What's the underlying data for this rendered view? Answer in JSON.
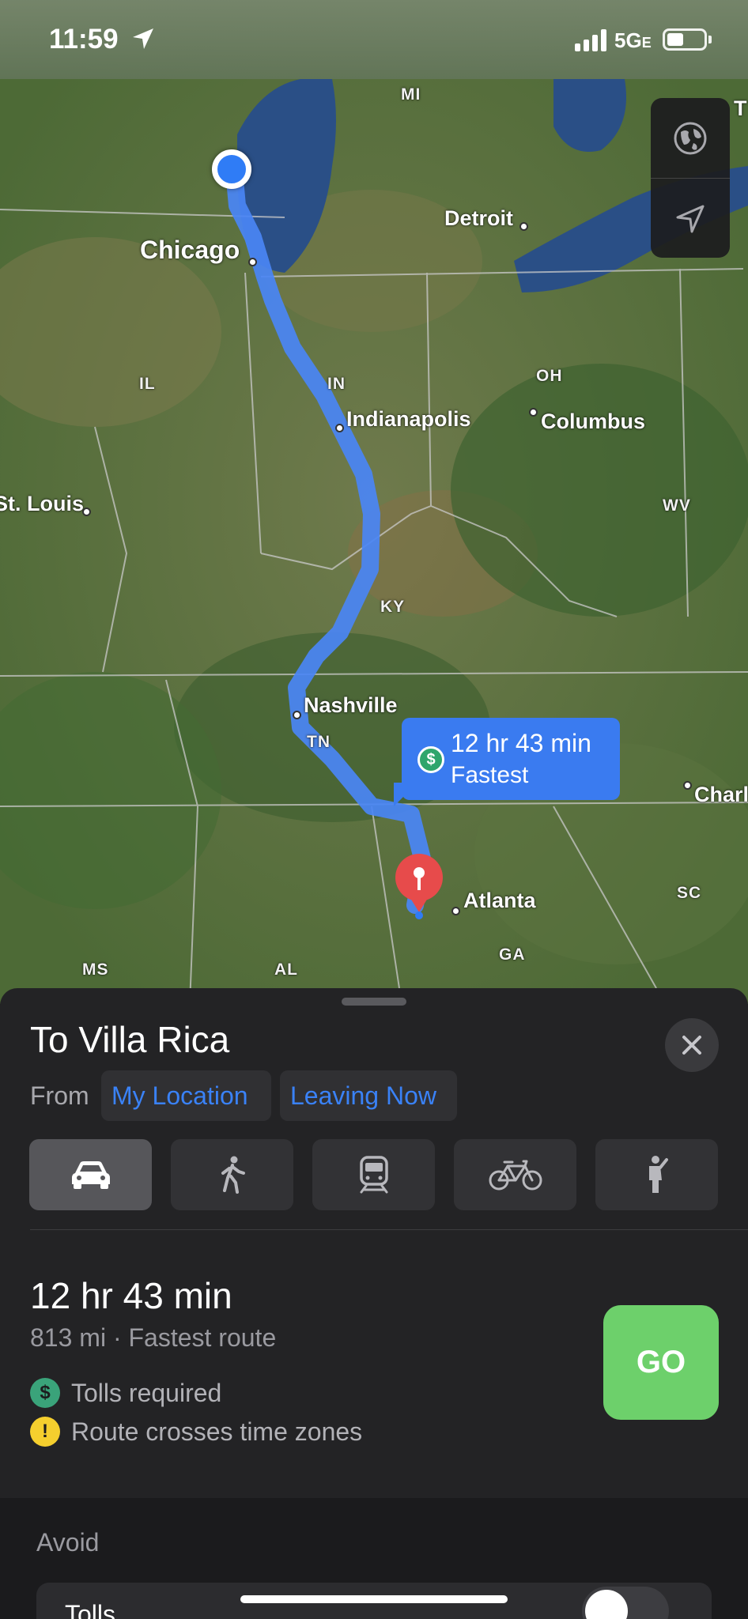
{
  "status_bar": {
    "time": "11:59",
    "network": "5G",
    "network_suffix": "E"
  },
  "map": {
    "labels": {
      "mi": "MI",
      "detroit": "Detroit",
      "chicago": "Chicago",
      "il": "IL",
      "in": "IN",
      "oh": "OH",
      "indianapolis": "Indianapolis",
      "columbus": "Columbus",
      "st_louis": "St. Louis",
      "wv": "WV",
      "ky": "KY",
      "nashville": "Nashville",
      "tn": "TN",
      "charlotte": "Charl",
      "atlanta": "Atlanta",
      "sc": "SC",
      "ga": "GA",
      "ms": "MS",
      "al": "AL",
      "toledo": "T"
    },
    "callout": {
      "toll_symbol": "$",
      "time": "12 hr 43 min",
      "label": "Fastest"
    },
    "colors": {
      "route": "#4a86f5",
      "water": "#2a4f86",
      "pin": "#e74b4b"
    }
  },
  "sheet": {
    "title": "To Villa Rica",
    "from_label": "From",
    "from_location": "My Location",
    "departure": "Leaving Now",
    "modes": [
      "car-icon",
      "walk-icon",
      "transit-icon",
      "bike-icon",
      "rideshare-icon"
    ],
    "route": {
      "time": "12 hr 43 min",
      "summary": "813 mi · Fastest route",
      "notes": [
        {
          "icon": "$",
          "text": "Tolls required"
        },
        {
          "icon": "!",
          "text": "Route crosses time zones"
        }
      ]
    },
    "go_label": "GO",
    "avoid": {
      "label": "Avoid",
      "tolls_label": "Tolls"
    },
    "colors": {
      "go": "#6dd06b",
      "accent": "#3a82f7"
    }
  }
}
